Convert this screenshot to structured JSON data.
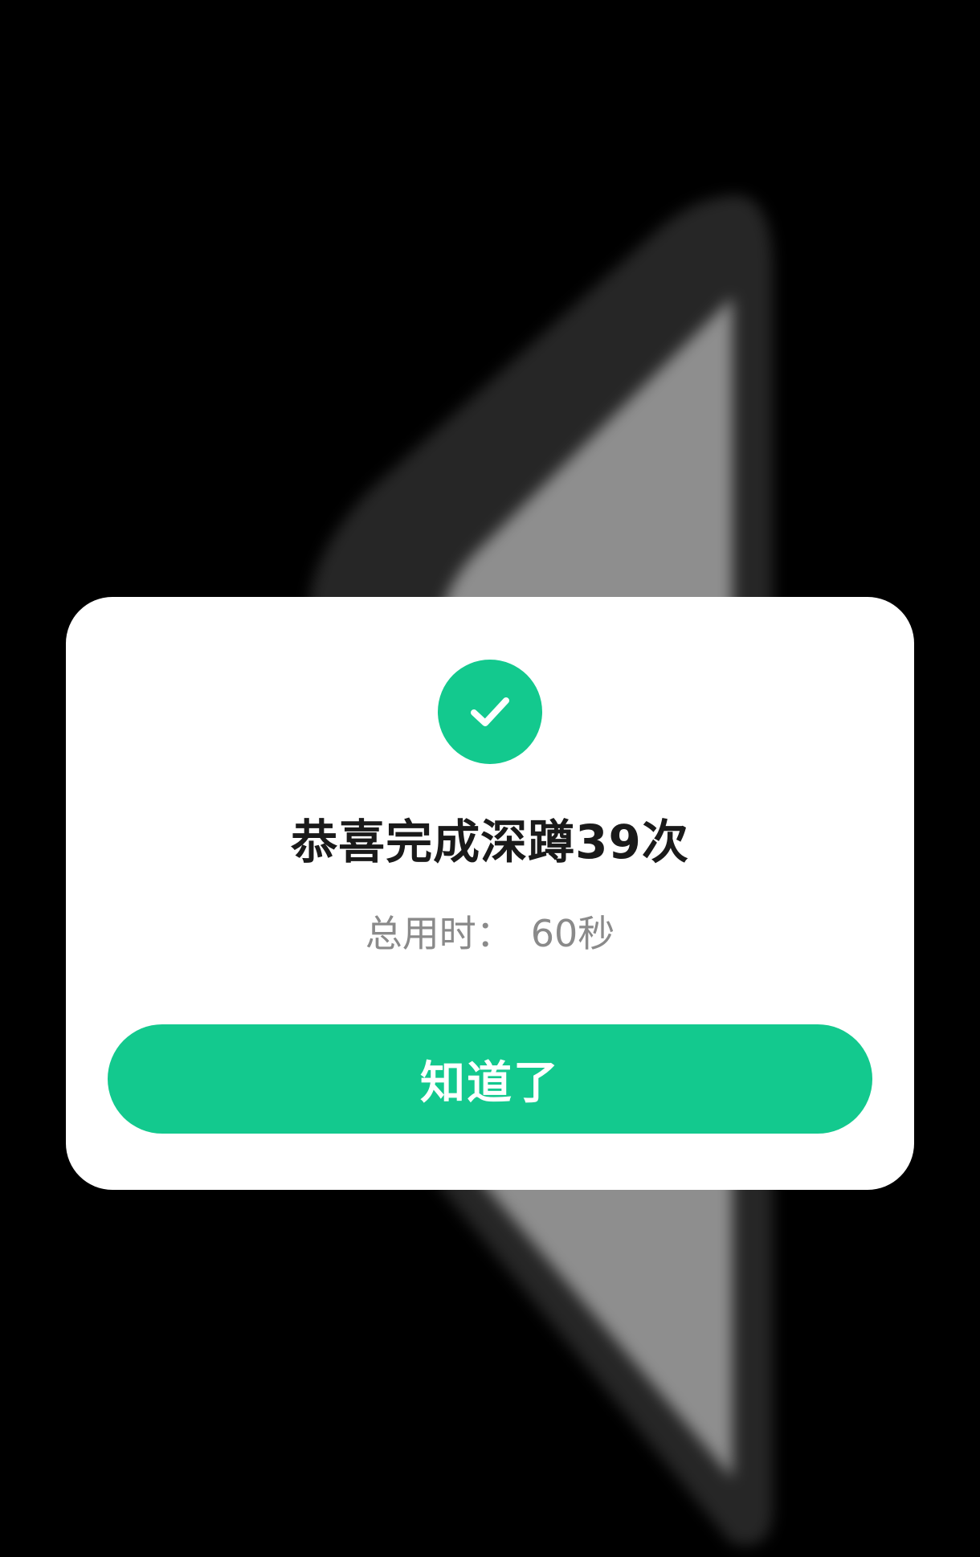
{
  "dialog": {
    "title": "恭喜完成深蹲39次",
    "duration_label": "总用时：",
    "duration_value": "60秒",
    "confirm_label": "知道了"
  },
  "icons": {
    "success": "check-circle-icon"
  },
  "colors": {
    "accent": "#13c98e",
    "background": "#000000",
    "dialog_background": "#ffffff",
    "title_text": "#1a1a1a",
    "secondary_text": "#8a8a8a"
  }
}
